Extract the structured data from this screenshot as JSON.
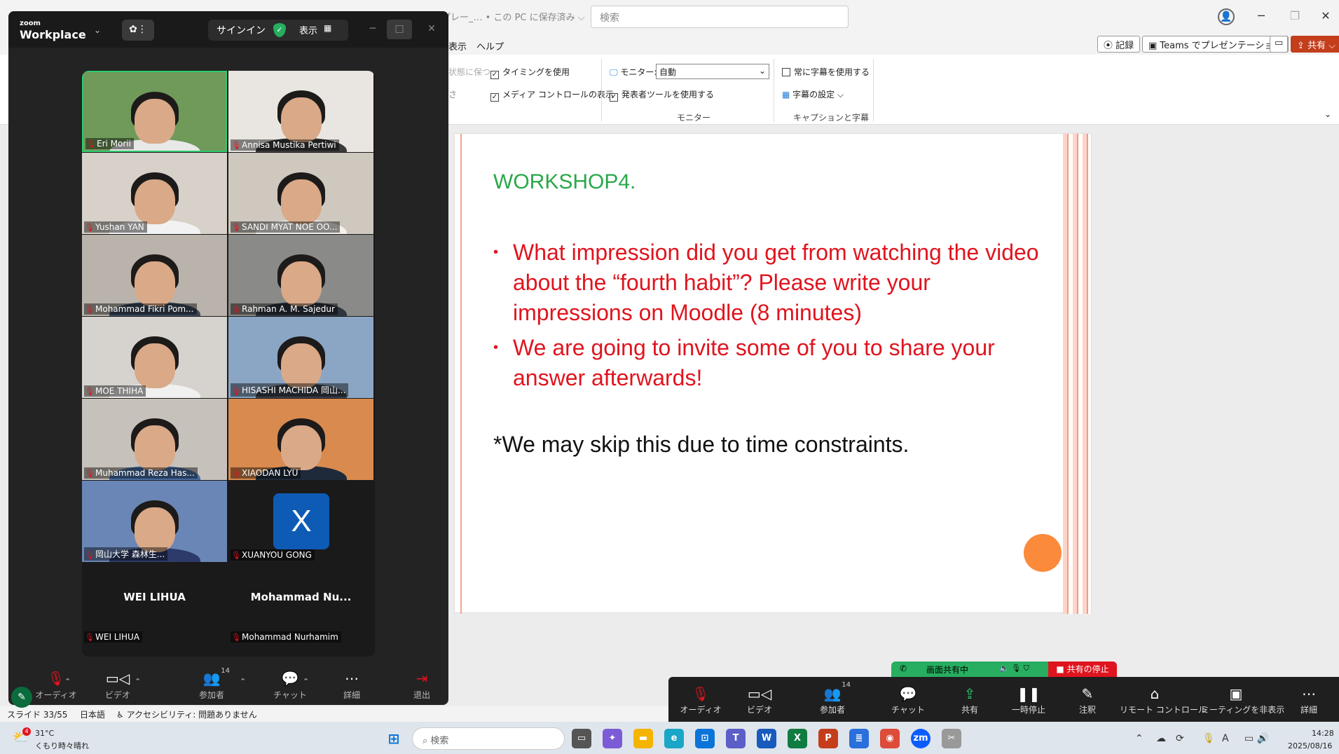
{
  "ppt": {
    "doc_name": "プレー_… • この PC に保存済み ⌵",
    "search_placeholder": "検索",
    "menus": [
      "表示",
      "ヘルプ"
    ],
    "ribbon_buttons": {
      "record": "記録",
      "teams": "Teams でプレゼンテーション",
      "share": "共有"
    },
    "ribbon": {
      "keep_state": "状態に保つ",
      "timing": "タイミングを使用",
      "media_controls": "メディア コントロールの表示",
      "monitor_label": "モニター:",
      "monitor_value": "自動",
      "presenter_tools": "発表者ツールを使用する",
      "monitor_group": "モニター",
      "always_captions": "常に字幕を使用する",
      "caption_settings": "字幕の設定 ⌵",
      "captions_group": "キャプションと字幕"
    },
    "slide": {
      "title": "WORKSHOP4.",
      "bullets": [
        "What impression did you get from watching the video about the “fourth habit”? Please write your impressions on Moodle (8 minutes)",
        "We are going to invite some of you to share your answer afterwards!"
      ],
      "note": "*We may skip this due to time constraints."
    },
    "status": {
      "slide": "スライド 33/55",
      "lang": "日本語",
      "accessibility": "アクセシビリティ: 問題ありません"
    }
  },
  "zoom": {
    "logo_top": "zoom",
    "logo_bottom": "Workplace",
    "signin": "サインイン",
    "view": "表示",
    "participants": [
      {
        "name": "Eri Morii",
        "bg": "#6f9a5a",
        "shirt": "#e8e8e8"
      },
      {
        "name": "Annisa Mustika Pertiwi",
        "bg": "#e9e6e2",
        "shirt": "#3a3a3a"
      },
      {
        "name": "Yushan YAN",
        "bg": "#d8d1c9",
        "shirt": "#f2f2f2"
      },
      {
        "name": "SANDI MYAT NOE OO...",
        "bg": "#cfc8bf",
        "shirt": "#f4f1ec"
      },
      {
        "name": "Mohammad Fikri Pom...",
        "bg": "#b9b3ab",
        "shirt": "#3b4a5c"
      },
      {
        "name": "Rahman A. M. Sajedur",
        "bg": "#8a8a88",
        "shirt": "#2f3640"
      },
      {
        "name": "MOE THIHA",
        "bg": "#d6d3cf",
        "shirt": "#f0f0f0"
      },
      {
        "name": "HISASHI MACHIDA 岡山...",
        "bg": "#8aa6c4",
        "shirt": "#39404c"
      },
      {
        "name": "Muhammad Reza Has...",
        "bg": "#c6c1ba",
        "shirt": "#4a6fa5"
      },
      {
        "name": "XIAODAN LYU",
        "bg": "#d98a4e",
        "shirt": "#1e2a3a"
      },
      {
        "name": "岡山大学 森林生...",
        "bg": "#6a86b6",
        "shirt": "#2d3b6b"
      },
      {
        "name": "XUANYOU GONG",
        "avatar": "X"
      },
      {
        "name": "WEI LIHUA",
        "big": "WEI LIHUA"
      },
      {
        "name": "Mohammad Nurhamim",
        "big": "Mohammad  Nu..."
      }
    ],
    "toolbar": {
      "audio": "オーディオ",
      "video": "ビデオ",
      "participants": "参加者",
      "participants_count": "14",
      "chat": "チャット",
      "more": "詳細",
      "leave": "退出"
    }
  },
  "share_bar": {
    "status": "画面共有中",
    "stop": "共有の停止",
    "buttons": [
      "オーディオ",
      "ビデオ",
      "参加者",
      "チャット",
      "共有",
      "一時停止",
      "注釈",
      "リモート コントロール",
      "ミーティングを非表示",
      "詳細"
    ],
    "participants_count": "14"
  },
  "taskbar": {
    "weather_temp": "31°C",
    "weather_desc": "くもり時々晴れ",
    "weather_badge": "4",
    "search": "検索",
    "time": "14:28",
    "date": "2025/08/16"
  }
}
